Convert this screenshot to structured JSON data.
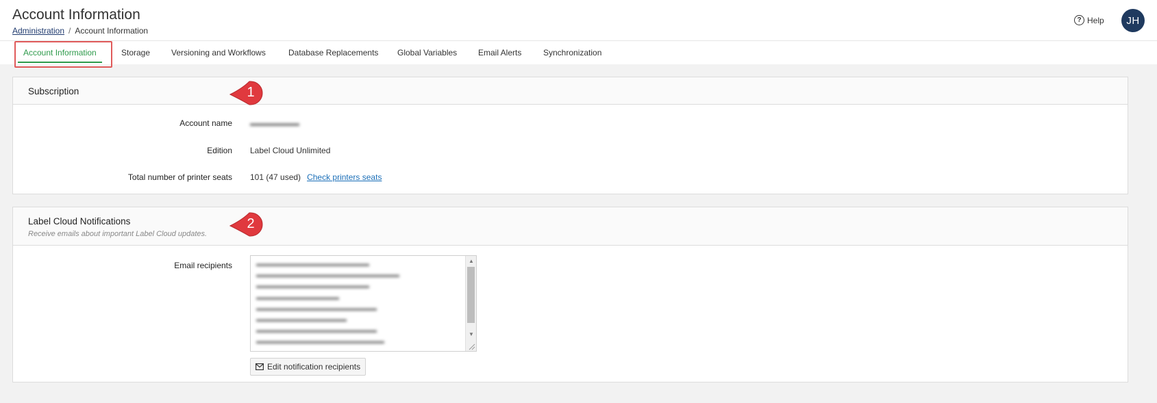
{
  "header": {
    "title": "Account Information",
    "breadcrumb": {
      "parent": "Administration",
      "separator": "/",
      "current": "Account Information"
    },
    "help_label": "Help",
    "avatar_initials": "JH"
  },
  "tabs": [
    {
      "label": "Account Information",
      "active": true
    },
    {
      "label": "Storage"
    },
    {
      "label": "Versioning and Workflows"
    },
    {
      "label": "Database Replacements"
    },
    {
      "label": "Global Variables"
    },
    {
      "label": "Email Alerts"
    },
    {
      "label": "Synchronization"
    }
  ],
  "subscription": {
    "title": "Subscription",
    "callout": "1",
    "account_name_label": "Account name",
    "account_name_value": "",
    "edition_label": "Edition",
    "edition_value": "Label Cloud Unlimited",
    "seats_label": "Total number of printer seats",
    "seats_value": "101 (47 used)",
    "seats_link": "Check printers seats"
  },
  "notifications": {
    "title": "Label Cloud Notifications",
    "subtitle": "Receive emails about important Label Cloud updates.",
    "callout": "2",
    "recipients_label": "Email recipients",
    "edit_button": "Edit notification recipients"
  },
  "colors": {
    "accent_green": "#2e9a4b",
    "callout_red": "#e0393e",
    "highlight_red": "#e05a5a",
    "avatar_bg": "#1f3a5f",
    "link_blue": "#1b6fb8"
  },
  "icons": {
    "help": "question-circle-icon",
    "edit": "envelope-icon"
  }
}
